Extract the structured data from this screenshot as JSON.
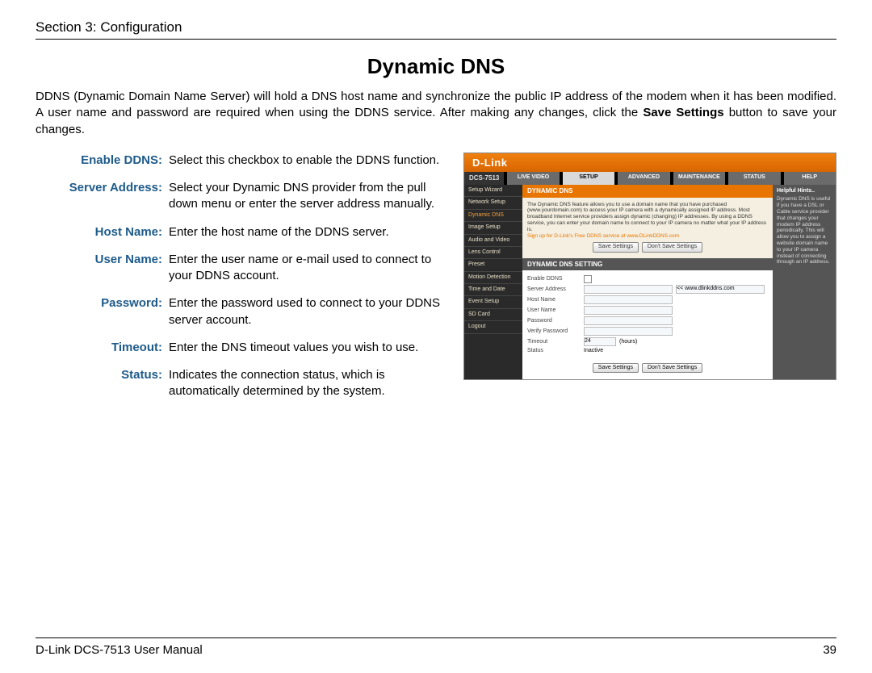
{
  "section_header": "Section 3: Configuration",
  "page_title": "Dynamic DNS",
  "intro_1": "DDNS (Dynamic Domain Name Server) will hold a DNS host name and synchronize the public IP address of the modem when it has been modified. A user name and password are required when using the DDNS service. After making any changes, click the ",
  "intro_bold": "Save Settings",
  "intro_2": " button to save your changes.",
  "defs": {
    "enable_ddns": {
      "term": "Enable DDNS:",
      "desc": "Select this checkbox to enable the DDNS function."
    },
    "server_address": {
      "term": "Server Address:",
      "desc": "Select your Dynamic DNS provider from the pull down menu or enter the server address manually."
    },
    "host_name": {
      "term": "Host Name:",
      "desc": "Enter the host name of the DDNS server."
    },
    "user_name": {
      "term": "User Name:",
      "desc": "Enter the user name or e-mail used to connect to your DDNS account."
    },
    "password": {
      "term": "Password:",
      "desc": "Enter the password used to connect to your DDNS server account."
    },
    "timeout": {
      "term": "Timeout:",
      "desc": "Enter the DNS timeout values you wish to use."
    },
    "status": {
      "term": "Status:",
      "desc": "Indicates the connection status, which is automatically determined by the system."
    }
  },
  "shot": {
    "brand": "D-Link",
    "model": "DCS-7513",
    "tabs": {
      "live": "LIVE VIDEO",
      "setup": "SETUP",
      "advanced": "ADVANCED",
      "maintenance": "MAINTENANCE",
      "status": "STATUS",
      "help": "HELP"
    },
    "side": [
      "Setup Wizard",
      "Network Setup",
      "Dynamic DNS",
      "Image Setup",
      "Audio and Video",
      "Lens Control",
      "Preset",
      "Motion Detection",
      "Time and Date",
      "Event Setup",
      "SD Card",
      "Logout"
    ],
    "side_sel": "Dynamic DNS",
    "main_title": "DYNAMIC DNS",
    "main_text": "The Dynamic DNS feature allows you to use a domain name that you have purchased (www.yourdomain.com) to access your IP camera with a dynamically assigned IP address. Most broadband Internet service providers assign dynamic (changing) IP addresses. By using a DDNS service, you can enter your domain name to connect to your IP camera no matter what your IP address is.",
    "signup": "Sign up for D-Link's Free DDNS service at www.DLinkDDNS.com",
    "btn_save": "Save Settings",
    "btn_dont": "Don't Save Settings",
    "setting_title": "DYNAMIC DNS SETTING",
    "form": {
      "enable": "Enable DDNS",
      "server": "Server Address",
      "server_dropdown": "<< www.dlinkddns.com",
      "host": "Host Name",
      "user": "User Name",
      "pass": "Password",
      "verify": "Verify Password",
      "timeout": "Timeout",
      "timeout_val": "24",
      "timeout_unit": "(hours)",
      "status": "Status",
      "status_val": "Inactive"
    },
    "right_h": "Helpful Hints..",
    "right_t": "Dynamic DNS is useful if you have a DSL or Cable service provider that changes your modem IP address periodically. This will allow you to assign a website domain name to your IP camera instead of connecting through an IP address."
  },
  "footer": {
    "left": "D-Link DCS-7513 User Manual",
    "right": "39"
  }
}
